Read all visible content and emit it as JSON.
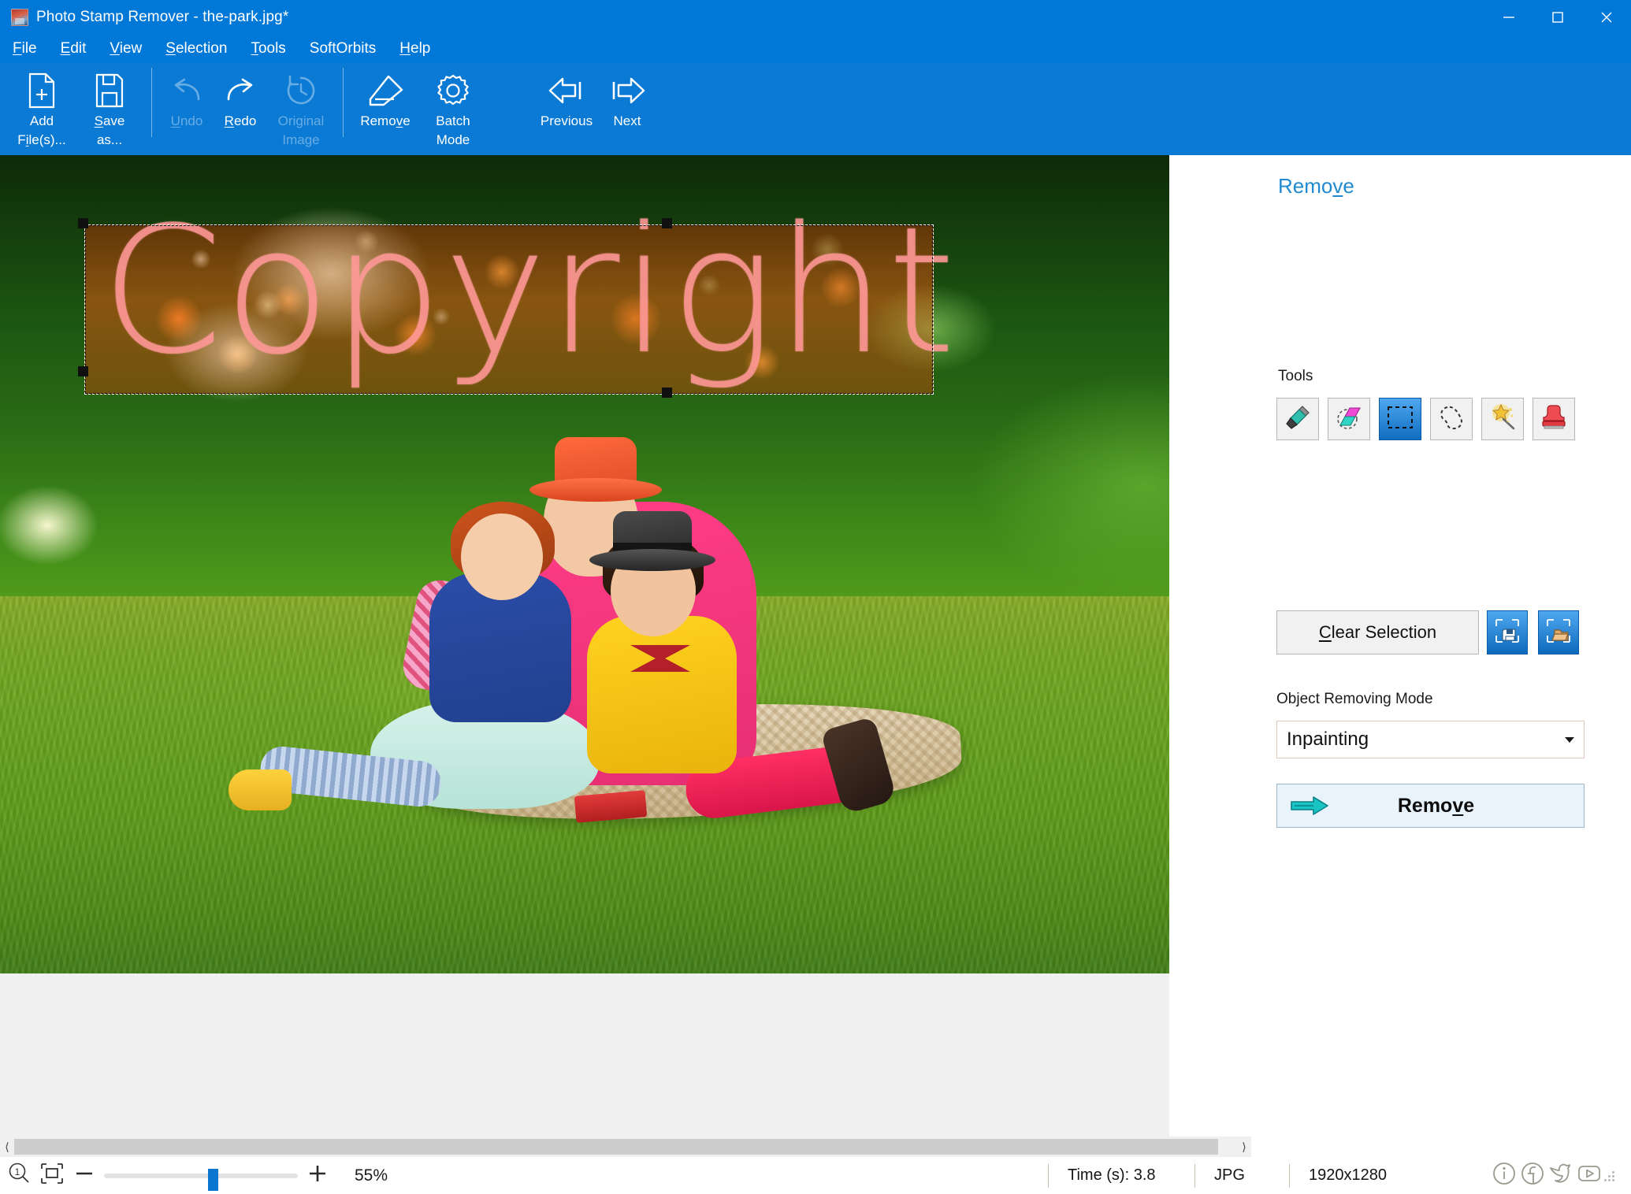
{
  "window": {
    "title": "Photo Stamp Remover - the-park.jpg*",
    "app_icon": "photo-stamp-remover-icon",
    "controls": {
      "minimize": "minimize-icon",
      "maximize": "maximize-icon",
      "close": "close-icon"
    }
  },
  "menu": {
    "items": [
      {
        "label": "File",
        "accel": "F"
      },
      {
        "label": "Edit",
        "accel": "E"
      },
      {
        "label": "View",
        "accel": "V"
      },
      {
        "label": "Selection",
        "accel": "S"
      },
      {
        "label": "Tools",
        "accel": "T"
      },
      {
        "label": "SoftOrbits",
        "accel": ""
      },
      {
        "label": "Help",
        "accel": "H"
      }
    ]
  },
  "toolbar": {
    "add_files": {
      "line1": "Add",
      "line2": "File(s)...",
      "accel": "i",
      "icon": "add-file-icon",
      "enabled": true
    },
    "save_as": {
      "line1": "Save",
      "line2": "as...",
      "accel": "S",
      "icon": "save-icon",
      "enabled": true
    },
    "undo": {
      "label": "Undo",
      "accel": "U",
      "icon": "undo-icon",
      "enabled": false
    },
    "redo": {
      "label": "Redo",
      "accel": "R",
      "icon": "redo-icon",
      "enabled": true
    },
    "original_image": {
      "line1": "Original",
      "line2": "Image",
      "icon": "history-icon",
      "enabled": false
    },
    "remove": {
      "label": "Remove",
      "accel": "v",
      "icon": "eraser-icon",
      "enabled": true
    },
    "batch_mode": {
      "line1": "Batch",
      "line2": "Mode",
      "icon": "gear-icon",
      "enabled": true
    },
    "previous": {
      "label": "Previous",
      "icon": "arrow-left-icon",
      "enabled": true
    },
    "next": {
      "label": "Next",
      "icon": "arrow-right-icon",
      "enabled": true
    }
  },
  "canvas": {
    "watermark_text": "Copyright",
    "selection": {
      "tool": "rectangle-selection",
      "active": true
    }
  },
  "panel": {
    "title": "Remove",
    "title_accel": "v",
    "tools_label": "Tools",
    "tools": [
      {
        "name": "marker-tool",
        "icon": "marker-icon",
        "selected": false
      },
      {
        "name": "eraser-tool",
        "icon": "eraser-dashed-icon",
        "selected": false
      },
      {
        "name": "rectangle-select-tool",
        "icon": "rectangle-select-icon",
        "selected": true
      },
      {
        "name": "lasso-tool",
        "icon": "lasso-icon",
        "selected": false
      },
      {
        "name": "magic-wand-tool",
        "icon": "magic-wand-icon",
        "selected": false
      },
      {
        "name": "stamp-tool",
        "icon": "stamp-icon",
        "selected": false
      }
    ],
    "clear_selection": {
      "label": "Clear Selection",
      "accel": "C"
    },
    "save_selection": {
      "icon": "save-selection-icon"
    },
    "load_selection": {
      "icon": "load-selection-icon"
    },
    "mode_label": "Object Removing Mode",
    "mode_value": "Inpainting",
    "remove_button": {
      "label": "Remove",
      "accel": "v",
      "icon": "green-arrow-icon"
    }
  },
  "statusbar": {
    "zoom_reset_icon": "zoom-1-to-1-icon",
    "fit_icon": "fit-to-window-icon",
    "zoom_out_icon": "minus-icon",
    "zoom_in_icon": "plus-icon",
    "zoom_percent": "55%",
    "zoom_slider_value": 55,
    "time": "Time (s): 3.8",
    "file_type": "JPG",
    "dimensions": "1920x1280",
    "social": [
      {
        "name": "info-icon",
        "glyph": "i"
      },
      {
        "name": "facebook-icon",
        "glyph": "f"
      },
      {
        "name": "twitter-icon",
        "glyph": "t"
      },
      {
        "name": "youtube-icon",
        "glyph": "y"
      }
    ]
  },
  "colors": {
    "titlebar": "#0078d7",
    "ribbon": "#0a7ad4",
    "panel_title": "#1f8ad0",
    "accent_blue": "#0b76d0",
    "watermark": "#ff9696"
  }
}
